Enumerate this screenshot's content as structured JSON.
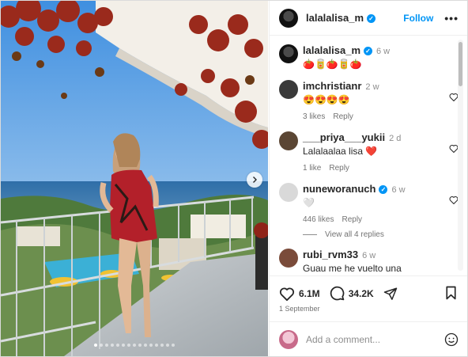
{
  "header": {
    "username": "lalalalisa_m",
    "follow_label": "Follow",
    "more_label": "•••"
  },
  "caption": {
    "username": "lalalalisa_m",
    "time": "6 w",
    "text": "🍅🥫🍅🥫🍅"
  },
  "comments": [
    {
      "username": "imchristianr",
      "time": "2 w",
      "text": "😍😍😍😍",
      "likes": "3 likes",
      "reply": "Reply"
    },
    {
      "username": "___priya___yukii",
      "time": "2 d",
      "text": "Lalalaalaa lisa ❤️",
      "likes": "1 like",
      "reply": "Reply"
    },
    {
      "username": "nuneworanuch",
      "time": "6 w",
      "text": "🤍",
      "likes": "446 likes",
      "reply": "Reply",
      "verified": true
    },
    {
      "username": "rubi_rvm33",
      "time": "6 w",
      "text": "Guau me he vuelto una"
    }
  ],
  "view_replies": "View all 4 replies",
  "actions": {
    "likes_count": "6.1M",
    "comments_count": "34.2K",
    "date": "1 September"
  },
  "add_comment": {
    "placeholder": "Add a comment..."
  },
  "carousel": {
    "total": 15,
    "active": 0
  },
  "colors": {
    "accent": "#0095f6",
    "text": "#262626",
    "muted": "#737373",
    "heart": "#ed4956"
  },
  "icons": [
    "heart-icon",
    "comment-icon",
    "share-icon",
    "bookmark-icon",
    "emoji-icon",
    "chevron-right-icon",
    "verified-badge-icon"
  ]
}
